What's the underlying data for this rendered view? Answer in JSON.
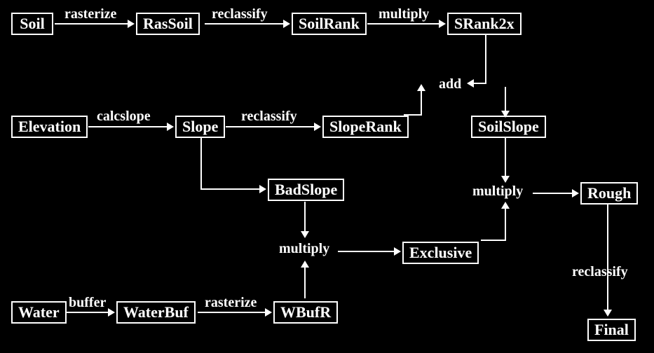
{
  "nodes": {
    "soil": {
      "label": "Soil"
    },
    "rassoil": {
      "label": "RasSoil"
    },
    "soilrank": {
      "label": "SoilRank"
    },
    "srank2x": {
      "label": "SRank2x"
    },
    "elevation": {
      "label": "Elevation"
    },
    "slope": {
      "label": "Slope"
    },
    "sloperank": {
      "label": "SlopeRank"
    },
    "soilslope": {
      "label": "SoilSlope"
    },
    "badslope": {
      "label": "BadSlope"
    },
    "rough": {
      "label": "Rough"
    },
    "exclusive": {
      "label": "Exclusive"
    },
    "water": {
      "label": "Water"
    },
    "waterbuf": {
      "label": "WaterBuf"
    },
    "wbufr": {
      "label": "WBufR"
    },
    "final": {
      "label": "Final"
    }
  },
  "edges": {
    "rasterize1": {
      "label": "rasterize"
    },
    "reclassify1": {
      "label": "reclassify"
    },
    "multiply1": {
      "label": "multiply"
    },
    "add": {
      "label": "add"
    },
    "calcslope": {
      "label": "calcslope"
    },
    "reclassify2": {
      "label": "reclassify"
    },
    "multiply2": {
      "label": "multiply"
    },
    "multiplyMid": {
      "label": "multiply"
    },
    "reclassify3": {
      "label": "reclassify"
    },
    "buffer": {
      "label": "buffer"
    },
    "rasterize2": {
      "label": "rasterize"
    }
  },
  "chart_data": {
    "type": "flow-diagram",
    "nodes": [
      "Soil",
      "RasSoil",
      "SoilRank",
      "SRank2x",
      "Elevation",
      "Slope",
      "SlopeRank",
      "SoilSlope",
      "BadSlope",
      "Rough",
      "Exclusive",
      "Water",
      "WaterBuf",
      "WBufR",
      "Final"
    ],
    "edges": [
      {
        "from": "Soil",
        "to": "RasSoil",
        "label": "rasterize"
      },
      {
        "from": "RasSoil",
        "to": "SoilRank",
        "label": "reclassify"
      },
      {
        "from": "SoilRank",
        "to": "SRank2x",
        "label": "multiply"
      },
      {
        "from": "SRank2x",
        "to": "SoilSlope",
        "label": "add"
      },
      {
        "from": "SlopeRank",
        "to": "SoilSlope",
        "label": "add"
      },
      {
        "from": "Elevation",
        "to": "Slope",
        "label": "calcslope"
      },
      {
        "from": "Slope",
        "to": "SlopeRank",
        "label": "reclassify"
      },
      {
        "from": "Slope",
        "to": "BadSlope",
        "label": ""
      },
      {
        "from": "SoilSlope",
        "to": "Rough",
        "label": "multiply"
      },
      {
        "from": "Exclusive",
        "to": "Rough",
        "label": "multiply"
      },
      {
        "from": "BadSlope",
        "to": "Exclusive",
        "label": "multiply"
      },
      {
        "from": "WBufR",
        "to": "Exclusive",
        "label": "multiply"
      },
      {
        "from": "Rough",
        "to": "Final",
        "label": "reclassify"
      },
      {
        "from": "Water",
        "to": "WaterBuf",
        "label": "buffer"
      },
      {
        "from": "WaterBuf",
        "to": "WBufR",
        "label": "rasterize"
      }
    ]
  }
}
